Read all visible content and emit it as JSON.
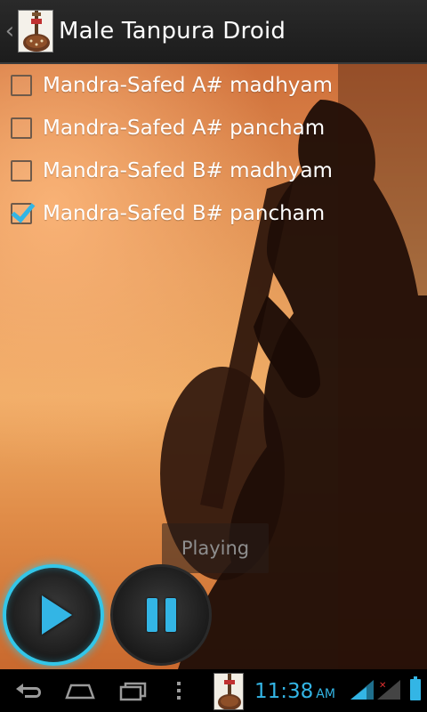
{
  "action_bar": {
    "title": "Male Tanpura Droid",
    "up_glyph": "‹",
    "app_icon": "tanpura-app-icon"
  },
  "options": [
    {
      "label": "Mandra-Safed A# madhyam",
      "checked": false
    },
    {
      "label": "Mandra-Safed A# pancham",
      "checked": false
    },
    {
      "label": "Mandra-Safed B# madhyam",
      "checked": false
    },
    {
      "label": "Mandra-Safed B# pancham",
      "checked": true
    }
  ],
  "status": {
    "text": "Playing"
  },
  "controls": {
    "play_icon": "play-icon",
    "pause_icon": "pause-icon"
  },
  "system_bar": {
    "time": "11:38",
    "ampm": "AM",
    "icons": [
      "back-icon",
      "home-icon",
      "recent-apps-icon",
      "overflow-menu-icon",
      "tanpura-notification-icon",
      "wifi-signal-icon",
      "cell-signal-icon",
      "battery-icon"
    ]
  },
  "colors": {
    "accent": "#33b5e5",
    "glow": "#33c6e8",
    "background_art": "#e59b5a"
  }
}
